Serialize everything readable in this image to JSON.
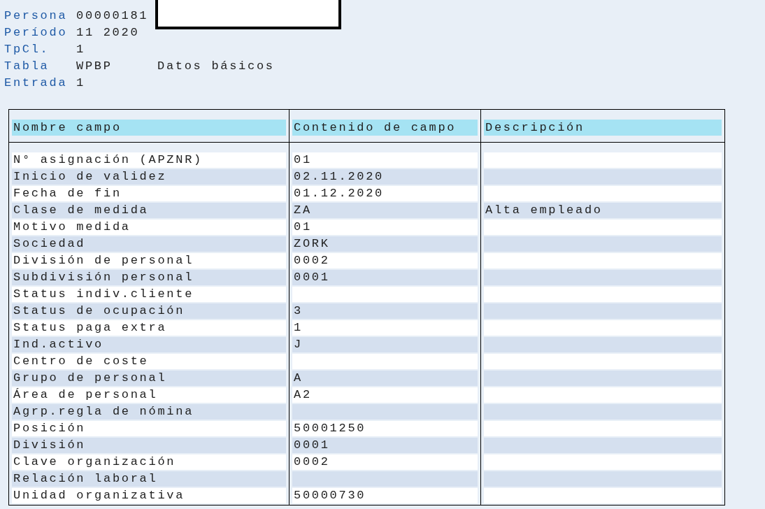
{
  "header": [
    {
      "label": "Persona",
      "value": "00000181",
      "redacted": true
    },
    {
      "label": "Período",
      "value": "11 2020"
    },
    {
      "label": "TpCl.",
      "value": "1"
    },
    {
      "label": "Tabla",
      "value": "WPBP",
      "description": "Datos básicos"
    },
    {
      "label": "Entrada",
      "value": "1"
    }
  ],
  "table": {
    "columns": [
      "Nombre campo",
      "Contenido de campo",
      "Descripción"
    ],
    "rows": [
      [
        "N° asignación (APZNR)",
        "01",
        ""
      ],
      [
        "Inicio de validez",
        "02.11.2020",
        ""
      ],
      [
        "Fecha de fin",
        "01.12.2020",
        ""
      ],
      [
        "Clase de medida",
        "ZA",
        "Alta empleado"
      ],
      [
        "Motivo medida",
        "01",
        ""
      ],
      [
        "Sociedad",
        "ZORK",
        ""
      ],
      [
        "División de personal",
        "0002",
        ""
      ],
      [
        "Subdivisión personal",
        "0001",
        ""
      ],
      [
        "Status indiv.cliente",
        "",
        ""
      ],
      [
        "Status de ocupación",
        "3",
        ""
      ],
      [
        "Status paga extra",
        "1",
        ""
      ],
      [
        "Ind.activo",
        "J",
        ""
      ],
      [
        "Centro de coste",
        "",
        ""
      ],
      [
        "Grupo de personal",
        "A",
        ""
      ],
      [
        "Área de personal",
        "A2",
        ""
      ],
      [
        "Agrp.regla de nómina",
        "",
        ""
      ],
      [
        "Posición",
        "50001250",
        ""
      ],
      [
        "División",
        "0001",
        ""
      ],
      [
        "Clave organización",
        "0002",
        ""
      ],
      [
        "Relación laboral",
        "",
        ""
      ],
      [
        "Unidad organizativa",
        "50000730",
        ""
      ]
    ]
  }
}
